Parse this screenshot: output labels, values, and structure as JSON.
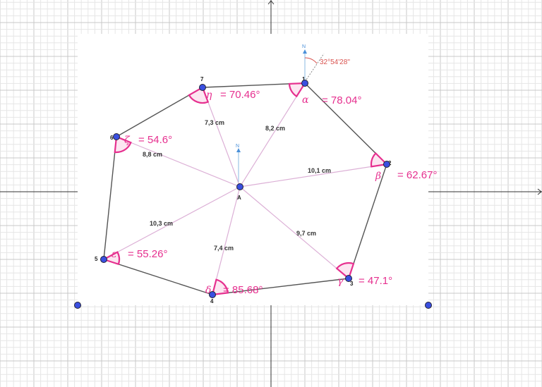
{
  "colors": {
    "edge": "#555555",
    "spoke": "#dcb0d6",
    "angle": "#e6308f",
    "point": "#3a4fe0",
    "grid_minor": "#e6e6e6",
    "grid_major": "#c8c8c8"
  },
  "center_label": "A",
  "north_label": "N",
  "bearing": "32°54'28''",
  "vertices": [
    {
      "label": "1",
      "angle_symbol": "α",
      "angle": "= 78.04°"
    },
    {
      "label": "2",
      "angle_symbol": "β",
      "angle": "= 62.67°"
    },
    {
      "label": "3",
      "angle_symbol": "γ",
      "angle": "= 47.1°"
    },
    {
      "label": "4",
      "angle_symbol": "δ",
      "angle": "= 85.68°"
    },
    {
      "label": "5",
      "angle_symbol": "ε",
      "angle": "= 55.26°"
    },
    {
      "label": "6",
      "angle_symbol": "ζ",
      "angle": "= 54.6°"
    },
    {
      "label": "7",
      "angle_symbol": "η",
      "angle": "= 70.46°"
    }
  ],
  "distances": [
    "8,2 cm",
    "10,1 cm",
    "9,7 cm",
    "7,4 cm",
    "10,3 cm",
    "8,8 cm",
    "7,3 cm"
  ]
}
